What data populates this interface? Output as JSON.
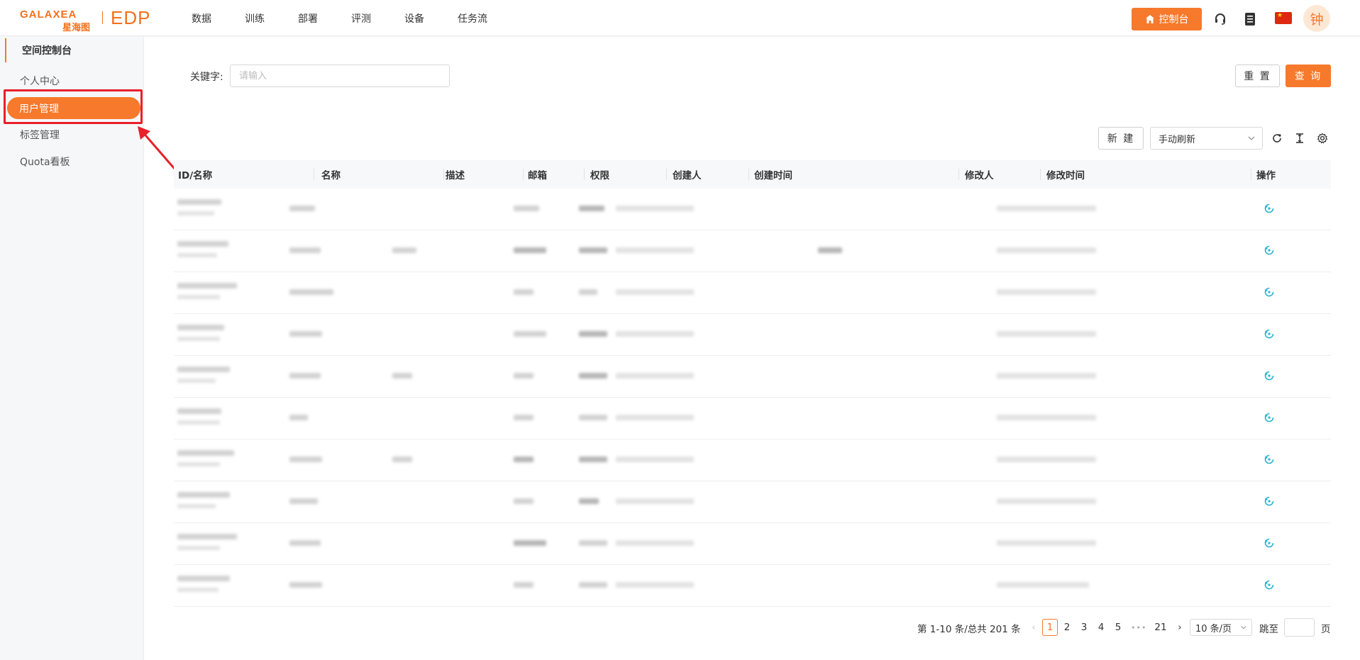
{
  "header": {
    "brand_en": "GALAXEA",
    "brand_cn": "星海图",
    "product": "EDP",
    "nav": [
      "数据",
      "训练",
      "部署",
      "评测",
      "设备",
      "任务流"
    ],
    "console_label": "控制台",
    "avatar_text": "钟"
  },
  "sidebar": {
    "section_title": "空间控制台",
    "items": [
      "个人中心",
      "用户管理",
      "标签管理",
      "Quota看板"
    ],
    "active_item": "用户管理"
  },
  "search": {
    "keyword_label": "关键字:",
    "keyword_placeholder": "请输入",
    "reset_label": "重 置",
    "query_label": "查 询"
  },
  "toolbar": {
    "new_label": "新 建",
    "refresh_mode": "手动刷新"
  },
  "table": {
    "columns": [
      "ID/名称",
      "名称",
      "描述",
      "邮箱",
      "权限",
      "创建人",
      "创建时间",
      "修改人",
      "修改时间",
      "操作"
    ]
  },
  "pagination": {
    "total_text": "第 1-10 条/总共 201 条",
    "pages": [
      "1",
      "2",
      "3",
      "4",
      "5",
      "21"
    ],
    "ellipsis": "•••",
    "current_page": "1",
    "page_size": "10 条/页",
    "jump_label": "跳至",
    "page_suffix": "页"
  },
  "colors": {
    "accent": "#f7792b",
    "highlight": "#e8202a",
    "op_icon": "#2ab3d1"
  }
}
